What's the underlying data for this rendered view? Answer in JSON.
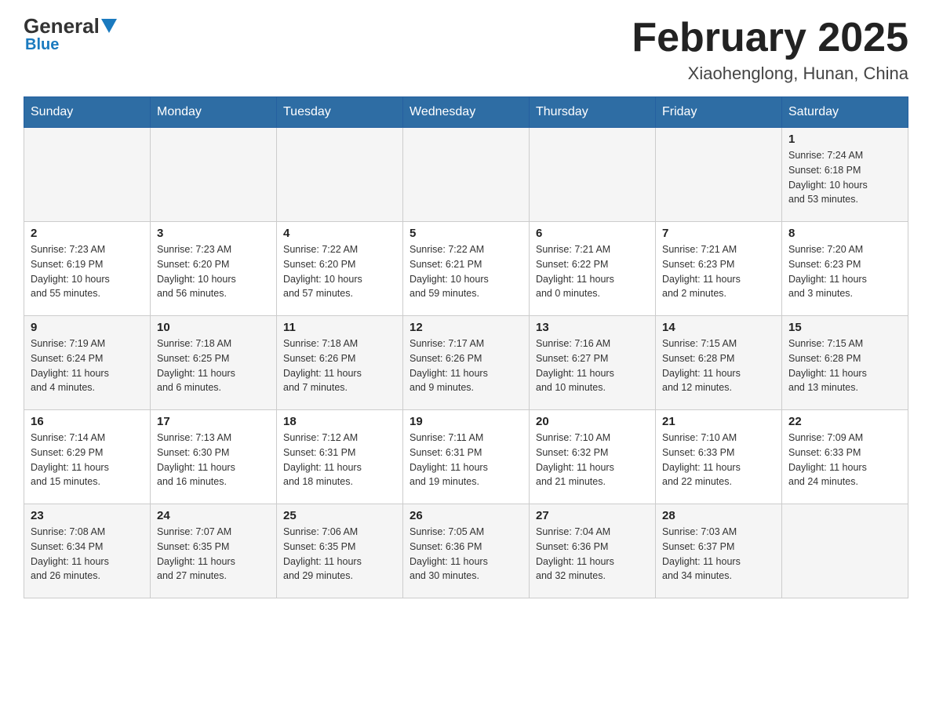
{
  "header": {
    "logo_general": "General",
    "logo_blue": "Blue",
    "title": "February 2025",
    "subtitle": "Xiaohenglong, Hunan, China"
  },
  "days_of_week": [
    "Sunday",
    "Monday",
    "Tuesday",
    "Wednesday",
    "Thursday",
    "Friday",
    "Saturday"
  ],
  "weeks": [
    [
      {
        "day": "",
        "info": ""
      },
      {
        "day": "",
        "info": ""
      },
      {
        "day": "",
        "info": ""
      },
      {
        "day": "",
        "info": ""
      },
      {
        "day": "",
        "info": ""
      },
      {
        "day": "",
        "info": ""
      },
      {
        "day": "1",
        "info": "Sunrise: 7:24 AM\nSunset: 6:18 PM\nDaylight: 10 hours\nand 53 minutes."
      }
    ],
    [
      {
        "day": "2",
        "info": "Sunrise: 7:23 AM\nSunset: 6:19 PM\nDaylight: 10 hours\nand 55 minutes."
      },
      {
        "day": "3",
        "info": "Sunrise: 7:23 AM\nSunset: 6:20 PM\nDaylight: 10 hours\nand 56 minutes."
      },
      {
        "day": "4",
        "info": "Sunrise: 7:22 AM\nSunset: 6:20 PM\nDaylight: 10 hours\nand 57 minutes."
      },
      {
        "day": "5",
        "info": "Sunrise: 7:22 AM\nSunset: 6:21 PM\nDaylight: 10 hours\nand 59 minutes."
      },
      {
        "day": "6",
        "info": "Sunrise: 7:21 AM\nSunset: 6:22 PM\nDaylight: 11 hours\nand 0 minutes."
      },
      {
        "day": "7",
        "info": "Sunrise: 7:21 AM\nSunset: 6:23 PM\nDaylight: 11 hours\nand 2 minutes."
      },
      {
        "day": "8",
        "info": "Sunrise: 7:20 AM\nSunset: 6:23 PM\nDaylight: 11 hours\nand 3 minutes."
      }
    ],
    [
      {
        "day": "9",
        "info": "Sunrise: 7:19 AM\nSunset: 6:24 PM\nDaylight: 11 hours\nand 4 minutes."
      },
      {
        "day": "10",
        "info": "Sunrise: 7:18 AM\nSunset: 6:25 PM\nDaylight: 11 hours\nand 6 minutes."
      },
      {
        "day": "11",
        "info": "Sunrise: 7:18 AM\nSunset: 6:26 PM\nDaylight: 11 hours\nand 7 minutes."
      },
      {
        "day": "12",
        "info": "Sunrise: 7:17 AM\nSunset: 6:26 PM\nDaylight: 11 hours\nand 9 minutes."
      },
      {
        "day": "13",
        "info": "Sunrise: 7:16 AM\nSunset: 6:27 PM\nDaylight: 11 hours\nand 10 minutes."
      },
      {
        "day": "14",
        "info": "Sunrise: 7:15 AM\nSunset: 6:28 PM\nDaylight: 11 hours\nand 12 minutes."
      },
      {
        "day": "15",
        "info": "Sunrise: 7:15 AM\nSunset: 6:28 PM\nDaylight: 11 hours\nand 13 minutes."
      }
    ],
    [
      {
        "day": "16",
        "info": "Sunrise: 7:14 AM\nSunset: 6:29 PM\nDaylight: 11 hours\nand 15 minutes."
      },
      {
        "day": "17",
        "info": "Sunrise: 7:13 AM\nSunset: 6:30 PM\nDaylight: 11 hours\nand 16 minutes."
      },
      {
        "day": "18",
        "info": "Sunrise: 7:12 AM\nSunset: 6:31 PM\nDaylight: 11 hours\nand 18 minutes."
      },
      {
        "day": "19",
        "info": "Sunrise: 7:11 AM\nSunset: 6:31 PM\nDaylight: 11 hours\nand 19 minutes."
      },
      {
        "day": "20",
        "info": "Sunrise: 7:10 AM\nSunset: 6:32 PM\nDaylight: 11 hours\nand 21 minutes."
      },
      {
        "day": "21",
        "info": "Sunrise: 7:10 AM\nSunset: 6:33 PM\nDaylight: 11 hours\nand 22 minutes."
      },
      {
        "day": "22",
        "info": "Sunrise: 7:09 AM\nSunset: 6:33 PM\nDaylight: 11 hours\nand 24 minutes."
      }
    ],
    [
      {
        "day": "23",
        "info": "Sunrise: 7:08 AM\nSunset: 6:34 PM\nDaylight: 11 hours\nand 26 minutes."
      },
      {
        "day": "24",
        "info": "Sunrise: 7:07 AM\nSunset: 6:35 PM\nDaylight: 11 hours\nand 27 minutes."
      },
      {
        "day": "25",
        "info": "Sunrise: 7:06 AM\nSunset: 6:35 PM\nDaylight: 11 hours\nand 29 minutes."
      },
      {
        "day": "26",
        "info": "Sunrise: 7:05 AM\nSunset: 6:36 PM\nDaylight: 11 hours\nand 30 minutes."
      },
      {
        "day": "27",
        "info": "Sunrise: 7:04 AM\nSunset: 6:36 PM\nDaylight: 11 hours\nand 32 minutes."
      },
      {
        "day": "28",
        "info": "Sunrise: 7:03 AM\nSunset: 6:37 PM\nDaylight: 11 hours\nand 34 minutes."
      },
      {
        "day": "",
        "info": ""
      }
    ]
  ]
}
